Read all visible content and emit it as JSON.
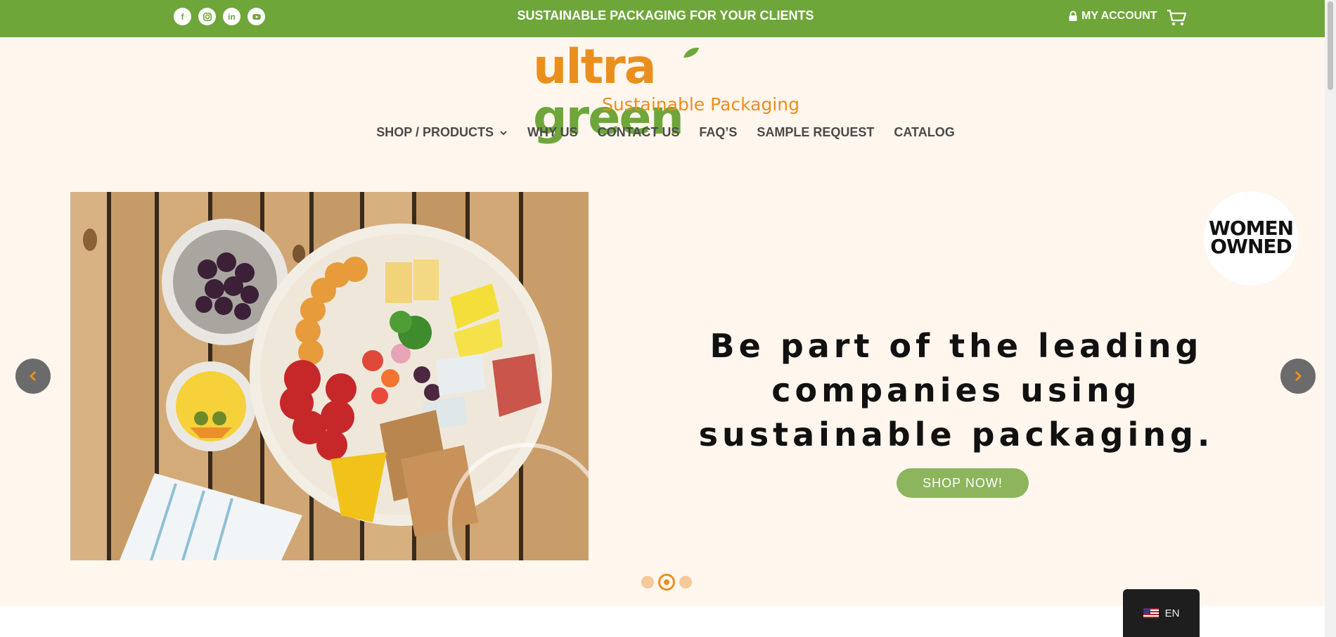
{
  "topbar": {
    "tagline": "SUSTAINABLE PACKAGING FOR YOUR CLIENTS",
    "account_label": "MY ACCOUNT",
    "social": [
      {
        "icon": "facebook-icon",
        "glyph": "f"
      },
      {
        "icon": "instagram-icon",
        "glyph": ""
      },
      {
        "icon": "linkedin-icon",
        "glyph": "in"
      },
      {
        "icon": "youtube-icon",
        "glyph": ""
      }
    ]
  },
  "logo": {
    "word1": "ultra ",
    "word2": "green",
    "subtitle": "Sustainable Packaging"
  },
  "nav": {
    "items": [
      {
        "label": "SHOP / PRODUCTS"
      },
      {
        "label": "WHY US"
      },
      {
        "label": "CONTACT US"
      },
      {
        "label": "FAQ’S"
      },
      {
        "label": "SAMPLE REQUEST"
      },
      {
        "label": "CATALOG"
      }
    ]
  },
  "hero": {
    "badge_line1": "WOMEN",
    "badge_line2": "OWNED",
    "headline": "Be part of the leading companies using sustainable packaging.",
    "cta": "SHOP NOW!",
    "slide_count": 3,
    "active_slide": 2
  },
  "language": {
    "code": "EN"
  },
  "colors": {
    "brand_green": "#6ea63a",
    "brand_orange": "#ea8f1e",
    "cream": "#fff6ee"
  }
}
